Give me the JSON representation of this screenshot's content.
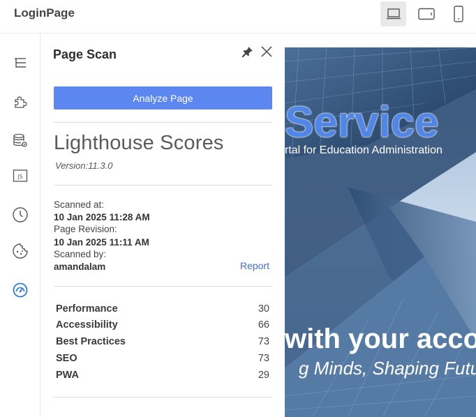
{
  "app": {
    "title": "LoginPage"
  },
  "devices": [
    {
      "name": "desktop",
      "active": true
    },
    {
      "name": "tablet",
      "active": false
    },
    {
      "name": "mobile",
      "active": false
    }
  ],
  "rail": [
    "layers-icon",
    "puzzle-icon",
    "database-gear-icon",
    "js-file-icon",
    "clock-icon",
    "cookie-icon",
    "gauge-icon"
  ],
  "panel": {
    "title": "Page Scan",
    "analyze_label": "Analyze Page",
    "lighthouse_title": "Lighthouse Scores",
    "version": "Version:11.3.0",
    "scanned_at_label": "Scanned at:",
    "scanned_at_value": "10 Jan 2025 11:28 AM",
    "page_revision_label": "Page Revision:",
    "page_revision_value": "10 Jan 2025 11:11 AM",
    "scanned_by_label": "Scanned by:",
    "scanned_by_value": "amandalam",
    "report_label": "Report",
    "scores": [
      {
        "name": "Performance",
        "value": "30"
      },
      {
        "name": "Accessibility",
        "value": "66"
      },
      {
        "name": "Best Practices",
        "value": "73"
      },
      {
        "name": "SEO",
        "value": "73"
      },
      {
        "name": "PWA",
        "value": "29"
      }
    ]
  },
  "preview": {
    "hero_title": "Service",
    "hero_subtitle": "rtal for Education Administration",
    "hero_with": "with your acco",
    "hero_tagline": "g Minds, Shaping Futu"
  },
  "colors": {
    "accent": "#5c86f0",
    "link": "#3f6fd0",
    "active_icon": "#2b7bd8"
  }
}
